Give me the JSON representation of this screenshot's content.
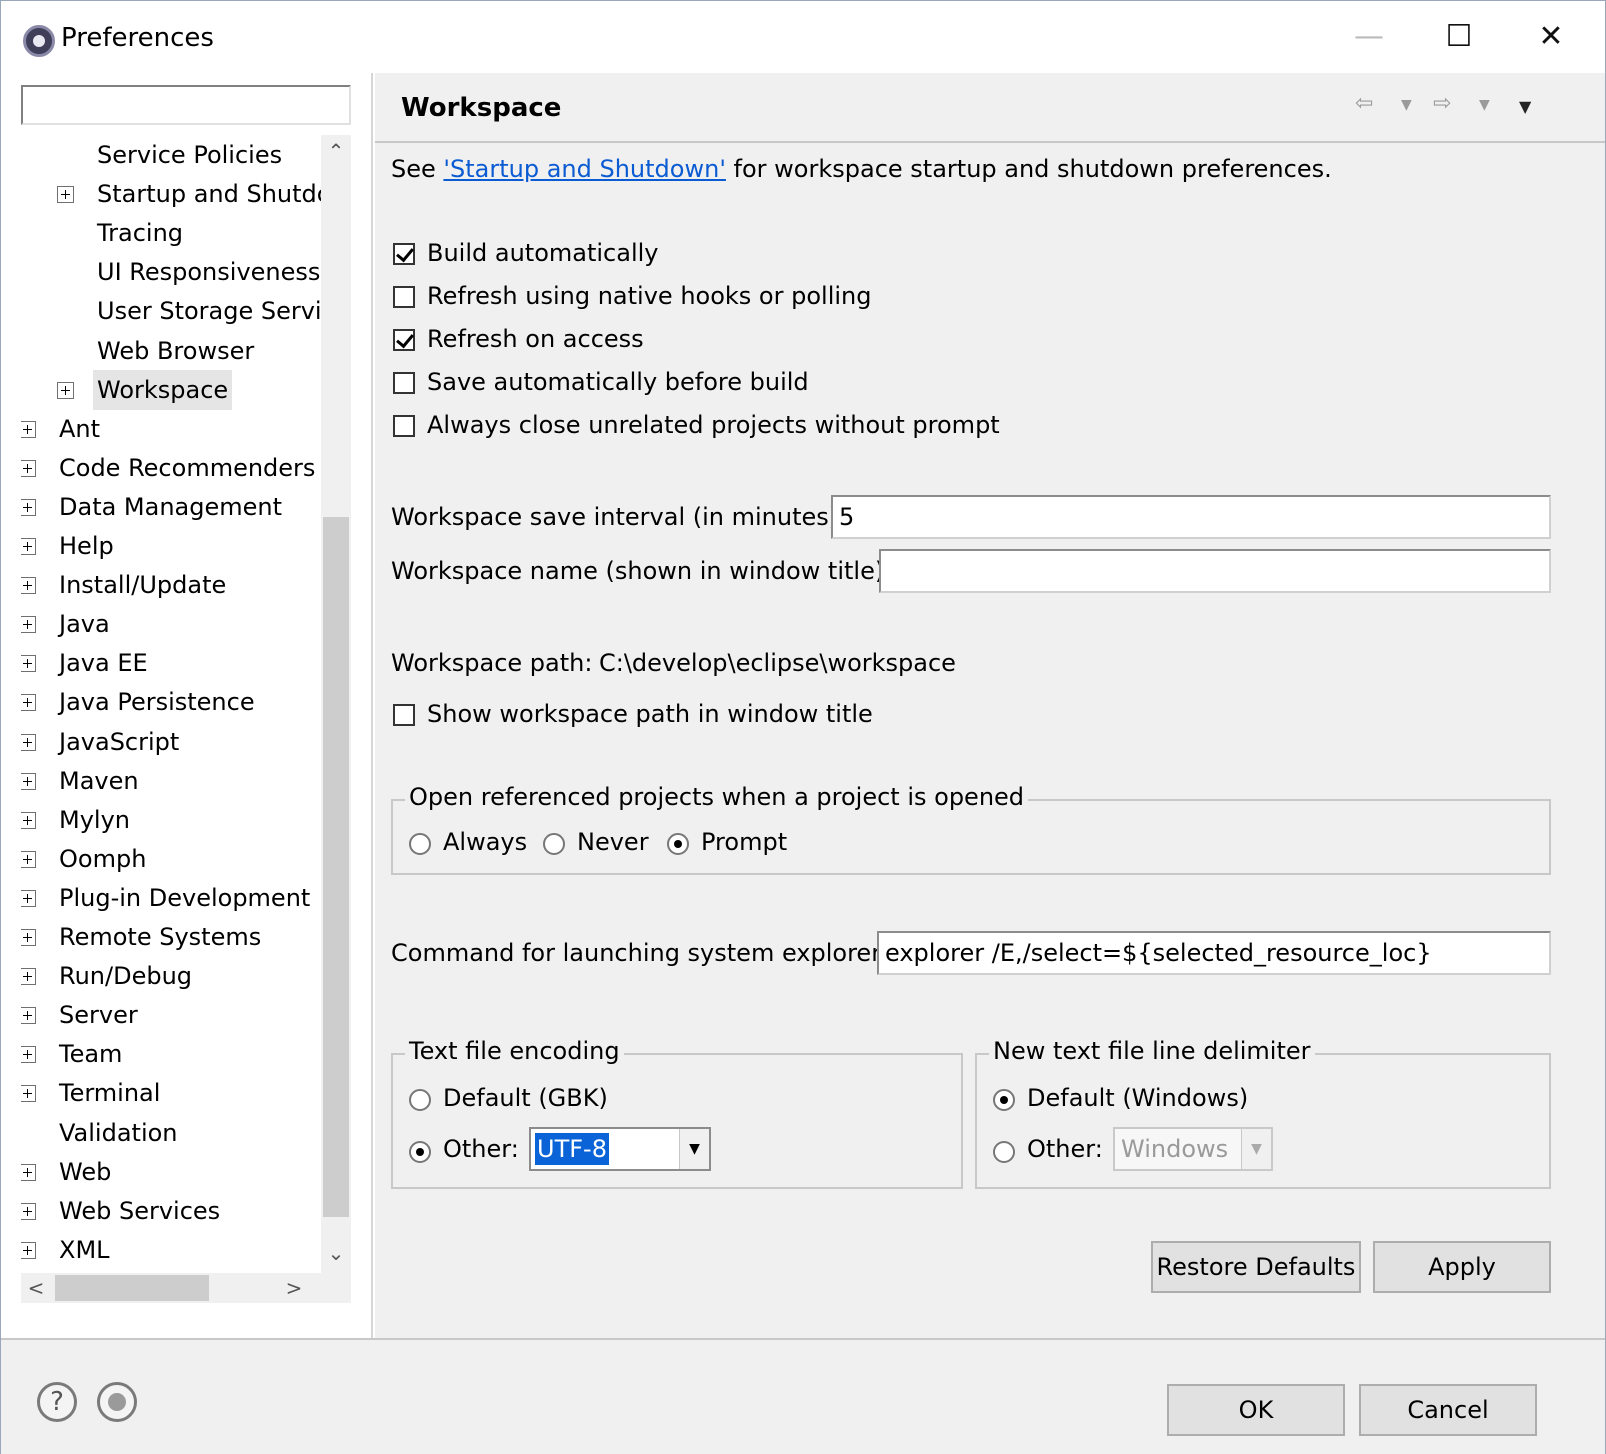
{
  "window": {
    "title": "Preferences",
    "min": "—",
    "max": "☐",
    "close": "✕"
  },
  "filter": {
    "value": ""
  },
  "tree": {
    "children_top": [
      "Service Policies",
      "Startup and Shutdc",
      "Tracing",
      "UI Responsiveness",
      "User Storage Servi",
      "Web Browser",
      "Workspace"
    ],
    "children_expandable": [
      false,
      true,
      false,
      false,
      false,
      false,
      true
    ],
    "roots": [
      "Ant",
      "Code Recommenders",
      "Data Management",
      "Help",
      "Install/Update",
      "Java",
      "Java EE",
      "Java Persistence",
      "JavaScript",
      "Maven",
      "Mylyn",
      "Oomph",
      "Plug-in Development",
      "Remote Systems",
      "Run/Debug",
      "Server",
      "Team",
      "Terminal",
      "Validation",
      "Web",
      "Web Services",
      "XML"
    ],
    "roots_expandable": [
      true,
      true,
      true,
      true,
      true,
      true,
      true,
      true,
      true,
      true,
      true,
      true,
      true,
      true,
      true,
      true,
      true,
      true,
      false,
      true,
      true,
      true
    ],
    "selected": "Workspace"
  },
  "page": {
    "title": "Workspace",
    "see_prefix": "See ",
    "see_link": "'Startup and Shutdown'",
    "see_suffix": " for workspace startup and shutdown preferences.",
    "build_auto": "Build automatically",
    "refresh_native": "Refresh using native hooks or polling",
    "refresh_access": "Refresh on access",
    "save_before_build": "Save automatically before build",
    "close_unrelated": "Always close unrelated projects without prompt",
    "save_interval_label": "Workspace save interval (in minutes):",
    "save_interval_value": "5",
    "ws_name_label": "Workspace name (shown in window title):",
    "ws_name_value": "",
    "ws_path_label": "Workspace path:",
    "ws_path_value": "C:\\develop\\eclipse\\workspace",
    "show_path": "Show workspace path in window title",
    "open_ref_group": "Open referenced projects when a project is opened",
    "opt_always": "Always",
    "opt_never": "Never",
    "opt_prompt": "Prompt",
    "cmd_label": "Command for launching system explorer:",
    "cmd_value": "explorer /E,/select=${selected_resource_loc}",
    "enc_group": "Text file encoding",
    "enc_default": "Default (GBK)",
    "enc_other": "Other:",
    "enc_value": "UTF-8",
    "delim_group": "New text file line delimiter",
    "delim_default": "Default (Windows)",
    "delim_other": "Other:",
    "delim_value": "Windows",
    "restore": "Restore Defaults",
    "apply": "Apply"
  },
  "checks": {
    "build_auto": true,
    "refresh_native": false,
    "refresh_access": true,
    "save_before_build": false,
    "close_unrelated": false,
    "show_path": false
  },
  "radios": {
    "open_ref": "Prompt",
    "encoding": "Other",
    "delimiter": "Default"
  },
  "footer": {
    "help_icon": "?",
    "ok": "OK",
    "cancel": "Cancel"
  },
  "icons": {
    "back": "⇦",
    "forward": "⇨",
    "dropdown": "▼",
    "menu": "▼",
    "scroll_up": "⌃",
    "scroll_down": "⌄",
    "scroll_left": "<",
    "scroll_right": ">"
  }
}
